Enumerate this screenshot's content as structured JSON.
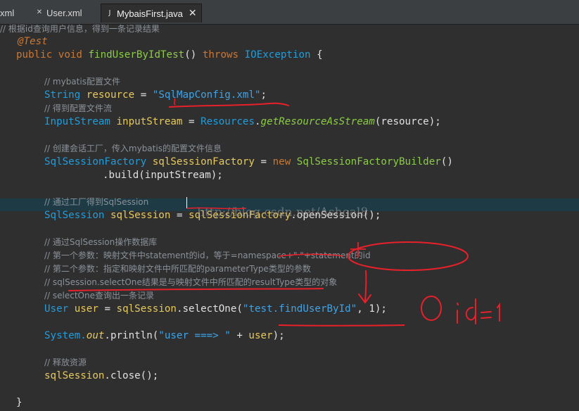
{
  "tabs": [
    {
      "label": "xml",
      "icon": "xml-file-icon"
    },
    {
      "label": "User.xml",
      "icon": "xml-file-icon"
    },
    {
      "label": "MybaisFirst.java",
      "icon": "java-file-icon",
      "active": true
    }
  ],
  "code": {
    "l0": "// 根据id查询用户信息，得到一条记录结果",
    "l1": "@Test",
    "l2_kw1": "public",
    "l2_kw2": "void",
    "l2_name": "findUserByIdTest",
    "l2_paren": "()",
    "l2_throws": "throws",
    "l2_ex": "IOException",
    "l2_brace": "{",
    "c1": "// mybatis配置文件",
    "l4_type": "String",
    "l4_var": "resource",
    "l4_eq": "=",
    "l4_str": "\"SqlMapConfig.xml\"",
    "l4_end": ";",
    "c2": "// 得到配置文件流",
    "l6_type": "InputStream",
    "l6_var": "inputStream",
    "l6_eq": "=",
    "l6_cls": "Resources",
    "l6_mth": "getResourceAsStream",
    "l6_arg": "(resource);",
    "c3": "// 创建会话工厂，传入mybatis的配置文件信息",
    "l9_type": "SqlSessionFactory",
    "l9_var": "sqlSessionFactory",
    "l9_eq": "=",
    "l9_new": "new",
    "l9_cls": "SqlSessionFactoryBuilder",
    "l9_end": "()",
    "l10": ".build(inputStream);",
    "c4": "// 通过工厂得到SqlSession",
    "l13_type": "SqlSession",
    "l13_var": "sqlSession",
    "l13_eq": "=",
    "l13_obj": "sqlSessionFactory",
    "l13_call": ".openSession();",
    "c5": "// 通过SqlSession操作数据库",
    "c6": "// 第一个参数：映射文件中statement的id，等于=namespace+\".\"+statement的id",
    "c7": "// 第二个参数：指定和映射文件中所匹配的parameterType类型的参数",
    "c8": "// sqlSession.selectOne结果是与映射文件中所匹配的resultType类型的对象",
    "c9": "// selectOne查询出一条记录",
    "l20_type": "User",
    "l20_var": "user",
    "l20_eq": "=",
    "l20_obj": "sqlSession",
    "l20_call": ".selectOne(",
    "l20_str": "\"test.findUserById\"",
    "l20_mid": ",",
    "l20_num": "1",
    "l20_end": ");",
    "l22_cls": "System.",
    "l22_out": "out",
    "l22_call": ".println(",
    "l22_str": "\"user ===> \"",
    "l22_plus": " + ",
    "l22_var": "user",
    "l22_end": ");",
    "c10": "// 释放资源",
    "l25_obj": "sqlSession",
    "l25_call": ".close();",
    "l27": "}"
  },
  "watermark": "http://blog.csdn.net/Ashoal8",
  "handwriting": "id=1",
  "colors": {
    "background": "#2f2f2f",
    "keyword": "#cc7832",
    "string": "#3fa3e6",
    "type": "#1f9ede",
    "variable": "#e6c95f",
    "method": "#8bcc45",
    "ink": "#e8202a"
  }
}
